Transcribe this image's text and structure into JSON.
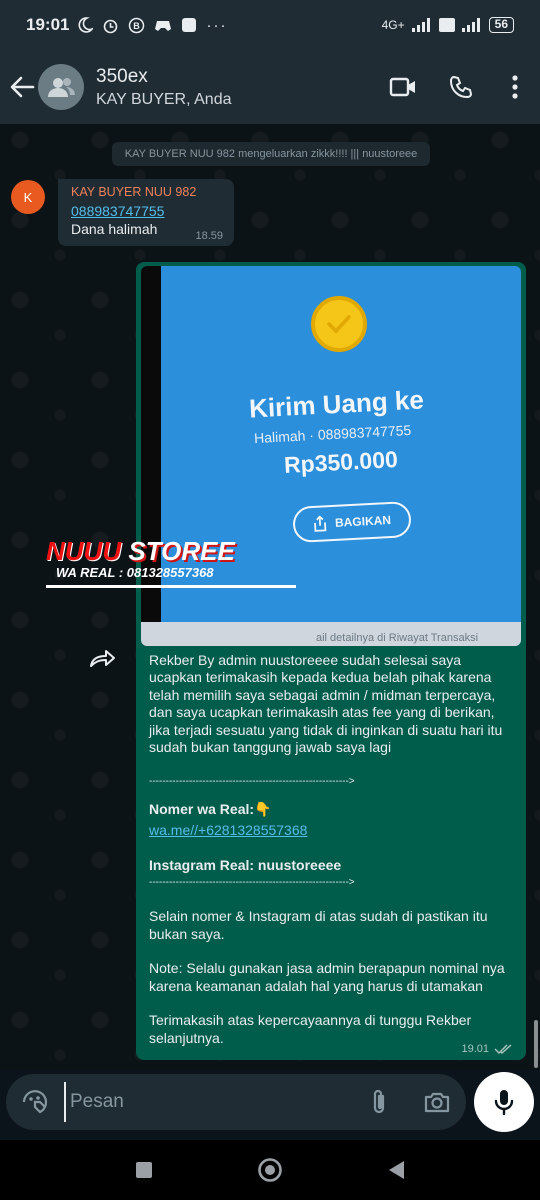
{
  "status_bar": {
    "time": "19:01",
    "network_label": "4G+",
    "battery": "56"
  },
  "header": {
    "title": "350ex",
    "subtitle": "KAY BUYER, Anda"
  },
  "system_message": "KAY BUYER NUU 982 mengeluarkan zikkk!!!! ||| nuustoreee",
  "incoming": {
    "avatar_letter": "K",
    "sender": "KAY BUYER NUU 982",
    "link": "088983747755",
    "text": "Dana halimah",
    "time": "18.59"
  },
  "outgoing": {
    "photo": {
      "title": "Kirim Uang ke",
      "recipient": "Halimah · 088983747755",
      "amount": "Rp350.000",
      "share_button": "BAGIKAN",
      "footer": "ail detailnya di Riwayat Transaksi",
      "watermark_brand_a": "NUUU",
      "watermark_brand_b": "STOREE",
      "watermark_wa": "WA REAL : 081328557368"
    },
    "paragraph1": "Rekber By admin nuustoreeee sudah selesai saya ucapkan terimakasih kepada kedua belah pihak karena telah memilih saya sebagai admin / midman terpercaya, dan saya ucapkan terimakasih atas fee yang di berikan, jika terjadi sesuatu yang tidak di inginkan di suatu hari itu sudah bukan tanggung jawab saya lagi",
    "divider1": "------------------------------------------------------------>",
    "nomer_label": "Nomer wa Real:👇",
    "nomer_link": "wa.me//+6281328557368",
    "instagram_label": "Instagram Real: nuustoreeee",
    "divider2": "------------------------------------------------------------>",
    "paragraph2": "Selain nomer & Instagram di atas sudah di pastikan itu bukan saya.",
    "paragraph3": "Note: Selalu gunakan jasa admin berapapun nominal nya karena keamanan adalah hal yang harus di utamakan",
    "paragraph4": "Terimakasih atas kepercayaannya di tunggu Rekber selanjutnya.",
    "time": "19.01"
  },
  "composer": {
    "placeholder": "Pesan"
  },
  "colors": {
    "header_bg": "#1f2c34",
    "outgoing_bubble": "#005c4b",
    "incoming_bubble": "#1f2c34",
    "link": "#53bdeb",
    "sender_name": "#f0815a"
  },
  "icons": {
    "back": "arrow-left-icon",
    "video": "video-camera-icon",
    "call": "phone-icon",
    "menu": "more-vertical-icon",
    "emoji": "sticker-icon",
    "attach": "paperclip-icon",
    "camera": "camera-icon",
    "mic": "microphone-icon",
    "forward": "forward-icon"
  }
}
